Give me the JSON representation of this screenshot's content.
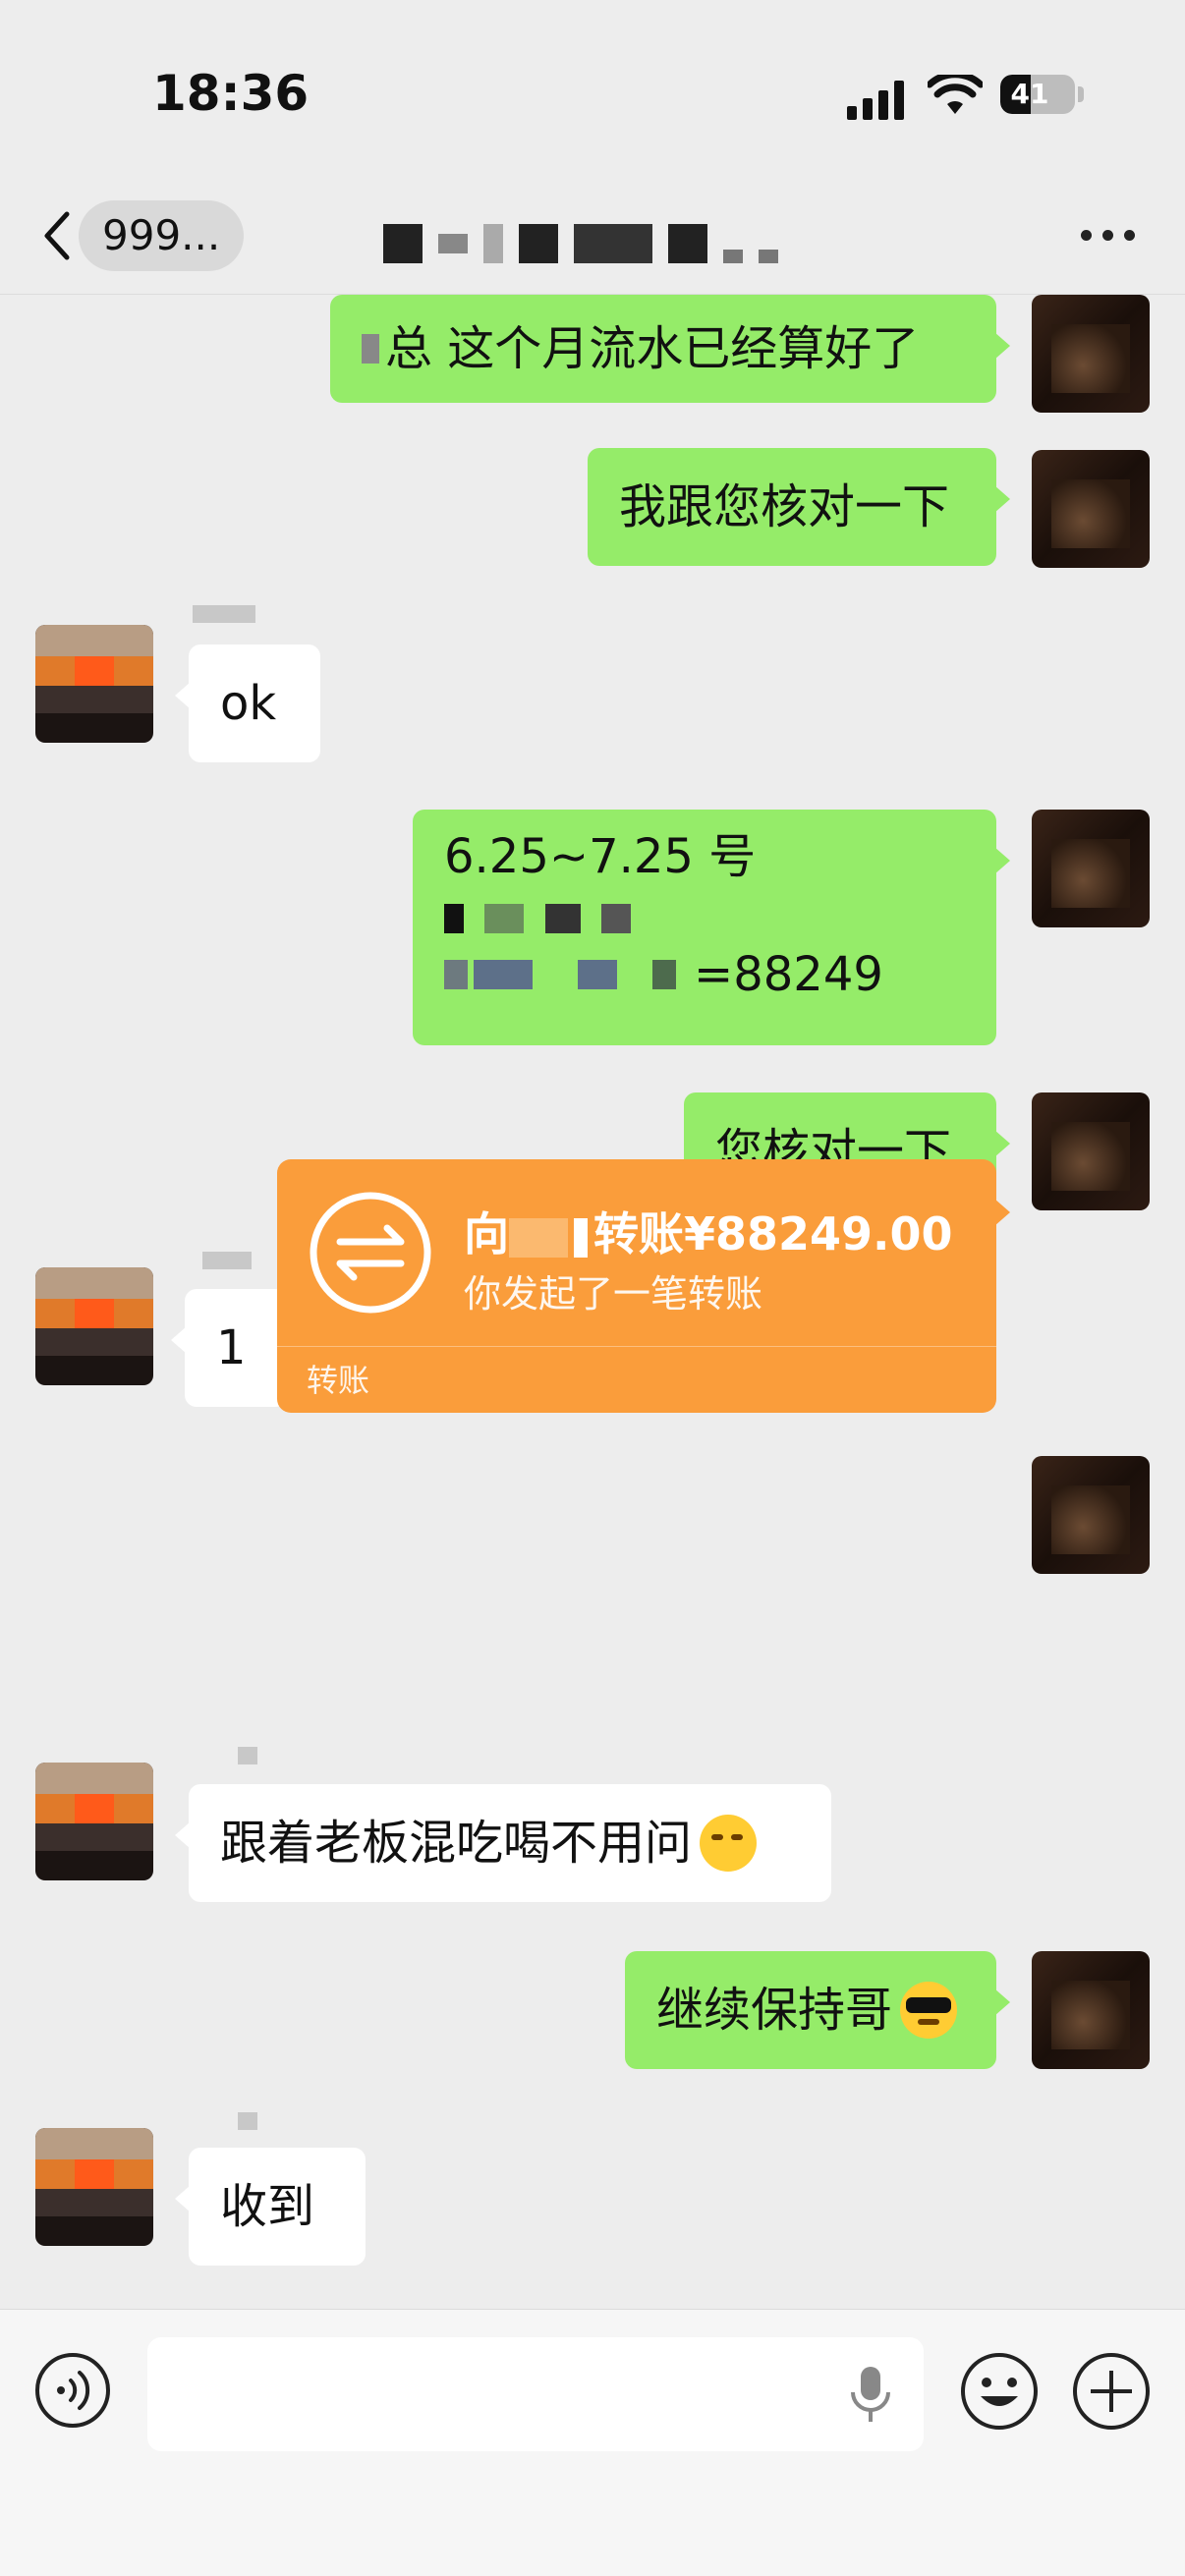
{
  "status_bar": {
    "time": "18:36",
    "battery_level": "41"
  },
  "nav": {
    "unread_count": "999..."
  },
  "messages": {
    "m1": "总 这个月流水已经算好了",
    "m2": "我跟您核对一下",
    "m3": "ok",
    "m4_line1": "6.25~7.25 号",
    "m4_line3": "=88249",
    "m5": "您核对一下",
    "m6": "1",
    "m8": "跟着老板混吃喝不用问",
    "m9": "继续保持哥",
    "m10": "收到"
  },
  "transfer": {
    "prefix": "向",
    "title": "转账¥88249.00",
    "subtitle": "你发起了一笔转账",
    "label": "转账"
  },
  "colors": {
    "bubble_me": "#95ec69",
    "bubble_other": "#ffffff",
    "transfer": "#fa9d3b",
    "background": "#ededed"
  },
  "icons": [
    "back-icon",
    "more-icon",
    "transfer-icon",
    "voice-icon",
    "mic-icon",
    "emoji-icon",
    "plus-icon",
    "signal-icon",
    "wifi-icon",
    "battery-icon"
  ]
}
